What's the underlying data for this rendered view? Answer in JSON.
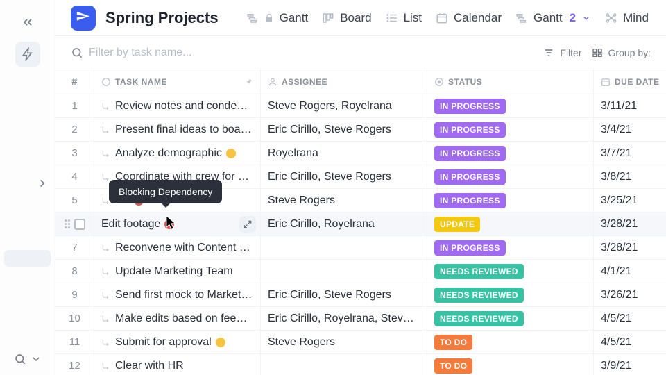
{
  "project_title": "Spring Projects",
  "views": [
    {
      "label": "Gantt",
      "locked": true
    },
    {
      "label": "Board"
    },
    {
      "label": "List"
    },
    {
      "label": "Calendar"
    },
    {
      "label": "Gantt",
      "count": "2"
    },
    {
      "label": "Mind Map"
    }
  ],
  "toolbar": {
    "filter_placeholder": "Filter by task name...",
    "filter_label": "Filter",
    "groupby_label": "Group by:"
  },
  "columns": {
    "num": "#",
    "task": "TASK NAME",
    "assignee": "ASSIGNEE",
    "status": "STATUS",
    "due": "DUE DATE"
  },
  "status_styles": {
    "IN PROGRESS": "#a06bf2",
    "UPDATE": "#f2c90f",
    "NEEDS REVIEWED": "#37c3a3",
    "TO DO": "#f47b3c"
  },
  "tooltip_text": "Blocking Dependency",
  "rows": [
    {
      "n": "1",
      "task": "Review notes and conden…",
      "assignee": "Steve Rogers, Royelrana",
      "status": "IN PROGRESS",
      "due": "3/11/21"
    },
    {
      "n": "2",
      "task": "Present final ideas to boa…",
      "assignee": "Eric Cirillo, Steve Rogers",
      "status": "IN PROGRESS",
      "due": "3/4/21"
    },
    {
      "n": "3",
      "task": "Analyze demographic",
      "assignee": "Royelrana",
      "status": "IN PROGRESS",
      "due": "3/7/21",
      "dep": "yellow"
    },
    {
      "n": "4",
      "task": "Coordinate with crew for cat…",
      "assignee": "Eric Cirillo, Steve Rogers",
      "status": "IN PROGRESS",
      "due": "3/8/21"
    },
    {
      "n": "5",
      "task": "…r",
      "assignee": "Steve Rogers",
      "status": "IN PROGRESS",
      "due": "3/25/21",
      "dep": "red"
    },
    {
      "n": "",
      "task": "Edit footage",
      "assignee": "Eric Cirillo, Royelrana",
      "status": "UPDATE",
      "due": "3/28/21",
      "dep": "red",
      "hovered": true
    },
    {
      "n": "7",
      "task": "Reconvene with Content …",
      "assignee": "",
      "status": "IN PROGRESS",
      "due": "3/28/21"
    },
    {
      "n": "8",
      "task": "Update Marketing Team",
      "assignee": "",
      "status": "NEEDS REVIEWED",
      "due": "4/1/21"
    },
    {
      "n": "9",
      "task": "Send first mock to Marketing…",
      "assignee": "Eric Cirillo, Steve Rogers",
      "status": "NEEDS REVIEWED",
      "due": "3/26/21"
    },
    {
      "n": "10",
      "task": "Make edits based on feedba…",
      "assignee": "Eric Cirillo, Royelrana, Steve …",
      "status": "NEEDS REVIEWED",
      "due": "4/5/21"
    },
    {
      "n": "11",
      "task": "Submit for approval",
      "assignee": "Steve Rogers",
      "status": "TO DO",
      "due": "4/5/21",
      "dep": "yellow"
    },
    {
      "n": "12",
      "task": "Clear with HR",
      "assignee": "",
      "status": "TO DO",
      "due": "3/9/21"
    }
  ]
}
